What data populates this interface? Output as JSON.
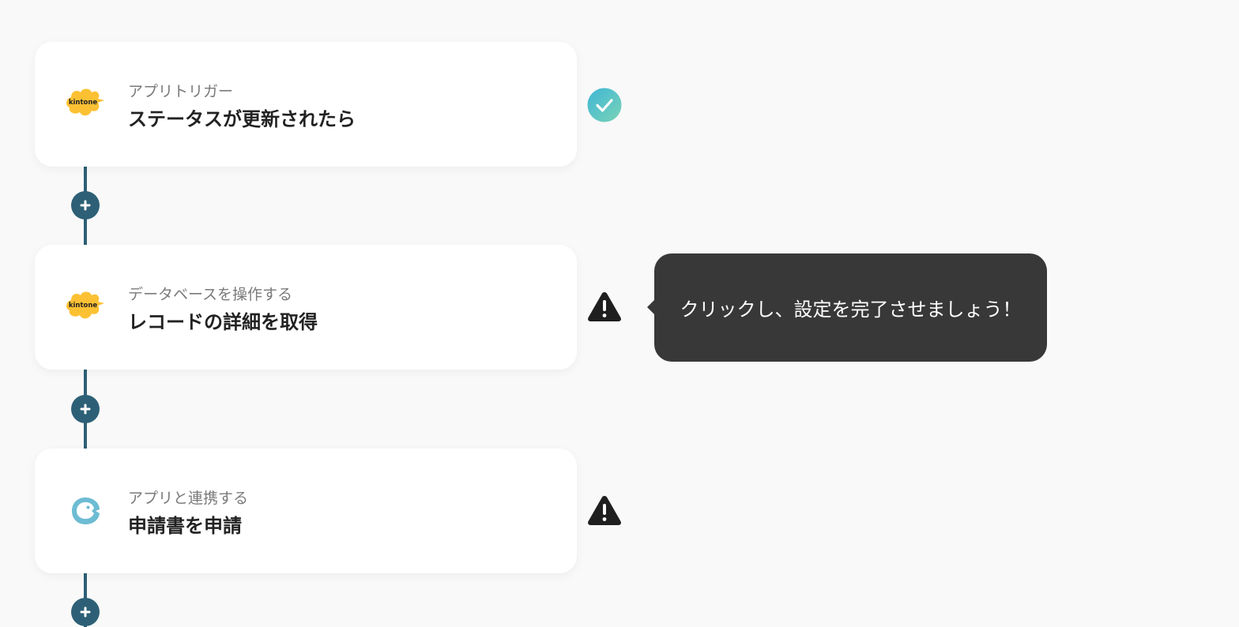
{
  "steps": [
    {
      "app_icon": "kintone-logo",
      "logo_text": "kintone",
      "subtitle": "アプリトリガー",
      "title": "ステータスが更新されたら",
      "status": "complete"
    },
    {
      "app_icon": "kintone-logo",
      "logo_text": "kintone",
      "subtitle": "データベースを操作する",
      "title": "レコードの詳細を取得",
      "status": "warning"
    },
    {
      "app_icon": "yoom-app-logo",
      "subtitle": "アプリと連携する",
      "title": "申請書を申請",
      "status": "warning"
    }
  ],
  "tooltip": {
    "text": "クリックし、設定を完了させましょう！"
  },
  "colors": {
    "connector": "#2d6076",
    "kintone_yellow": "#fcc133",
    "check_gradient_start": "#3fb7d6",
    "check_gradient_end": "#7ad3b6",
    "warning": "#1f1f1f",
    "tooltip_bg": "#383838",
    "app_logo": "#6dbcd3"
  }
}
